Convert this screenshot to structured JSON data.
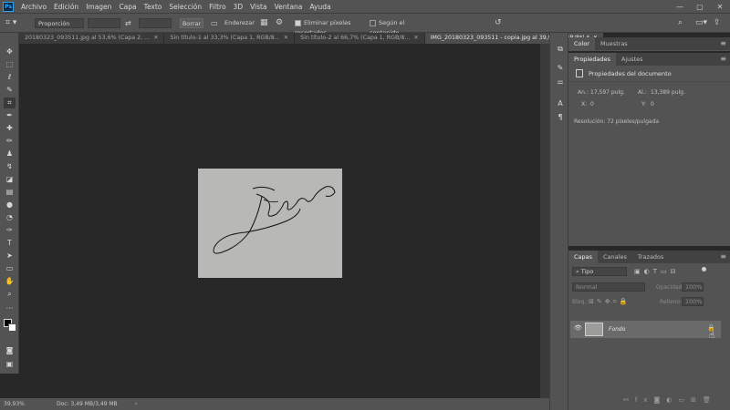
{
  "app": {
    "logo": "Ps"
  },
  "menu": [
    "Archivo",
    "Edición",
    "Imagen",
    "Capa",
    "Texto",
    "Selección",
    "Filtro",
    "3D",
    "Vista",
    "Ventana",
    "Ayuda"
  ],
  "window_controls": {
    "minimize": "—",
    "maximize": "▢",
    "close": "✕"
  },
  "options": {
    "ratio": "Proporción",
    "clear": "Borrar",
    "straighten": "Enderezar",
    "delete_cropped": "Eliminar píxeles recortados",
    "content_aware": "Según el contenido"
  },
  "tabs": [
    {
      "label": "20180323_093511.jpg al 53,6% (Capa 2, ..."
    },
    {
      "label": "Sin título-1 al 33,3% (Capa 1, RGB/8..."
    },
    {
      "label": "Sin título-2 al 66,7% (Capa 1, RGB/8..."
    },
    {
      "label": "IMG_20180323_093511 - copia.jpg al 39,9% (RGB/8*) *",
      "active": true
    }
  ],
  "right_top": {
    "tabs": [
      "Color",
      "Muestras"
    ]
  },
  "properties": {
    "tabs": [
      "Propiedades",
      "Ajustes"
    ],
    "title": "Propiedades del documento",
    "width_label": "An.:",
    "width_value": "17,597 pulg.",
    "height_label": "Al.:",
    "height_value": "13,389 pulg.",
    "x_label": "X:",
    "x_value": "0",
    "y_label": "Y:",
    "y_value": "0",
    "resolution": "Resolución: 72 píxeles/pulgada"
  },
  "layers_panel": {
    "tabs": [
      "Capas",
      "Canales",
      "Trazados"
    ],
    "filter": "Tipo",
    "blend_mode": "Normal",
    "opacity_label": "Opacidad:",
    "opacity_value": "100%",
    "lock_label": "Bloq.:",
    "fill_label": "Relleno:",
    "fill_value": "100%",
    "layer_name": "Fondo"
  },
  "status": {
    "zoom": "39,93%",
    "doc": "Doc: 3,49 MB/3,49 MB"
  },
  "colors": {
    "accent": "#31a8ff",
    "panel": "#535353",
    "canvas": "#282828"
  }
}
